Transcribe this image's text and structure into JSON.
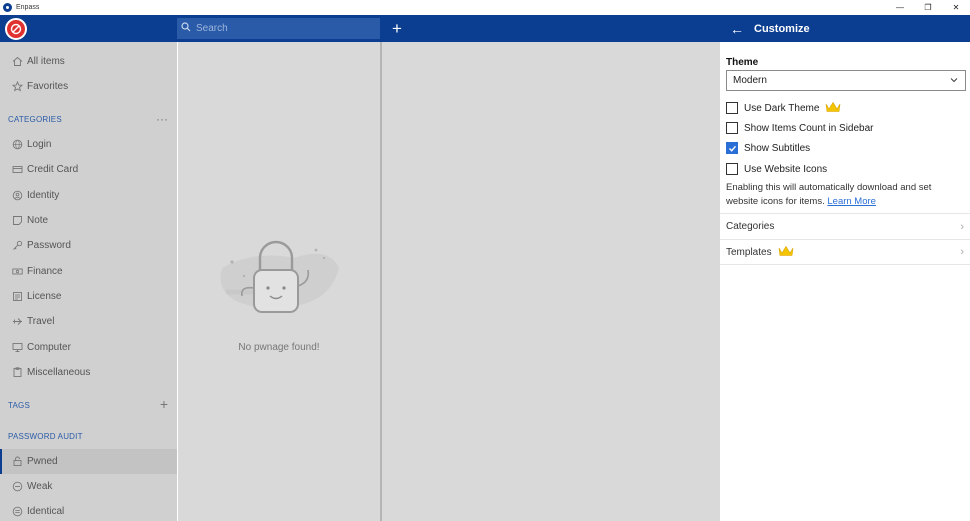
{
  "window": {
    "title": "Enpass",
    "minimize": "—",
    "maximize": "❐",
    "close": "✕"
  },
  "toolbar": {
    "search_placeholder": "Search",
    "add_label": "+"
  },
  "sidebar": {
    "top_items": [
      {
        "label": "All items",
        "icon": "home-icon"
      },
      {
        "label": "Favorites",
        "icon": "star-icon"
      }
    ],
    "categories_heading": "CATEGORIES",
    "categories_action": "···",
    "categories": [
      {
        "label": "Login",
        "icon": "globe-icon"
      },
      {
        "label": "Credit Card",
        "icon": "credit-card-icon"
      },
      {
        "label": "Identity",
        "icon": "identity-icon"
      },
      {
        "label": "Note",
        "icon": "note-icon"
      },
      {
        "label": "Password",
        "icon": "key-icon"
      },
      {
        "label": "Finance",
        "icon": "finance-icon"
      },
      {
        "label": "License",
        "icon": "license-icon"
      },
      {
        "label": "Travel",
        "icon": "plane-icon"
      },
      {
        "label": "Computer",
        "icon": "monitor-icon"
      },
      {
        "label": "Miscellaneous",
        "icon": "misc-icon"
      }
    ],
    "tags_heading": "TAGS",
    "tags_action": "+",
    "audit_heading": "PASSWORD AUDIT",
    "audit": [
      {
        "label": "Pwned",
        "icon": "pwned-icon",
        "active": true
      },
      {
        "label": "Weak",
        "icon": "weak-icon"
      },
      {
        "label": "Identical",
        "icon": "identical-icon"
      }
    ]
  },
  "list": {
    "empty_text": "No pwnage found!"
  },
  "customize": {
    "title": "Customize",
    "back": "←",
    "theme_label": "Theme",
    "theme_value": "Modern",
    "options": [
      {
        "label": "Use Dark Theme",
        "checked": false,
        "premium": true
      },
      {
        "label": "Show Items Count in Sidebar",
        "checked": false
      },
      {
        "label": "Show Subtitles",
        "checked": true
      },
      {
        "label": "Use Website Icons",
        "checked": false
      }
    ],
    "note_text": "Enabling this will automatically download and set website icons for items.",
    "note_link": "Learn More",
    "rows": [
      {
        "label": "Categories",
        "premium": false
      },
      {
        "label": "Templates",
        "premium": true
      }
    ],
    "chevron": "›"
  },
  "colors": {
    "brand": "#0b3d91",
    "accent": "#2a6fd6",
    "logo": "#e0302f",
    "crown": "#f5c400"
  }
}
